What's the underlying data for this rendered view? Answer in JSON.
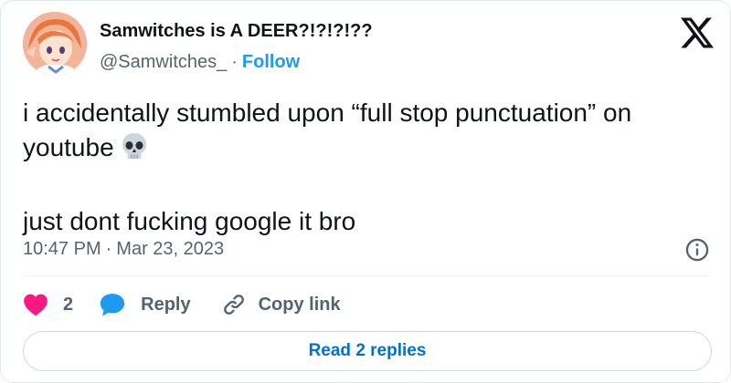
{
  "author": {
    "display_name": "Samwitches is A DEER?!?!?!??",
    "handle": "@Samwitches_",
    "separator": "·",
    "follow_label": "Follow"
  },
  "tweet": {
    "line1": "i accidentally stumbled upon “full stop punctuation” on",
    "line2": "youtube",
    "paragraph2": "just dont fucking google it bro",
    "emoji": "skull-emoji"
  },
  "meta": {
    "time": "10:47 PM",
    "separator": "·",
    "date": "Mar 23, 2023"
  },
  "actions": {
    "like_count": "2",
    "reply_label": "Reply",
    "copy_link_label": "Copy link"
  },
  "read_replies_label": "Read 2 replies",
  "icons": {
    "brand": "x-logo-icon",
    "info": "info-icon",
    "like": "heart-icon",
    "reply": "speech-bubble-icon",
    "copy": "link-icon"
  },
  "colors": {
    "text": "#0f1419",
    "secondary": "#536471",
    "accent": "#1d9bf0",
    "like": "#f91880",
    "reply_link": "#006fd6"
  }
}
